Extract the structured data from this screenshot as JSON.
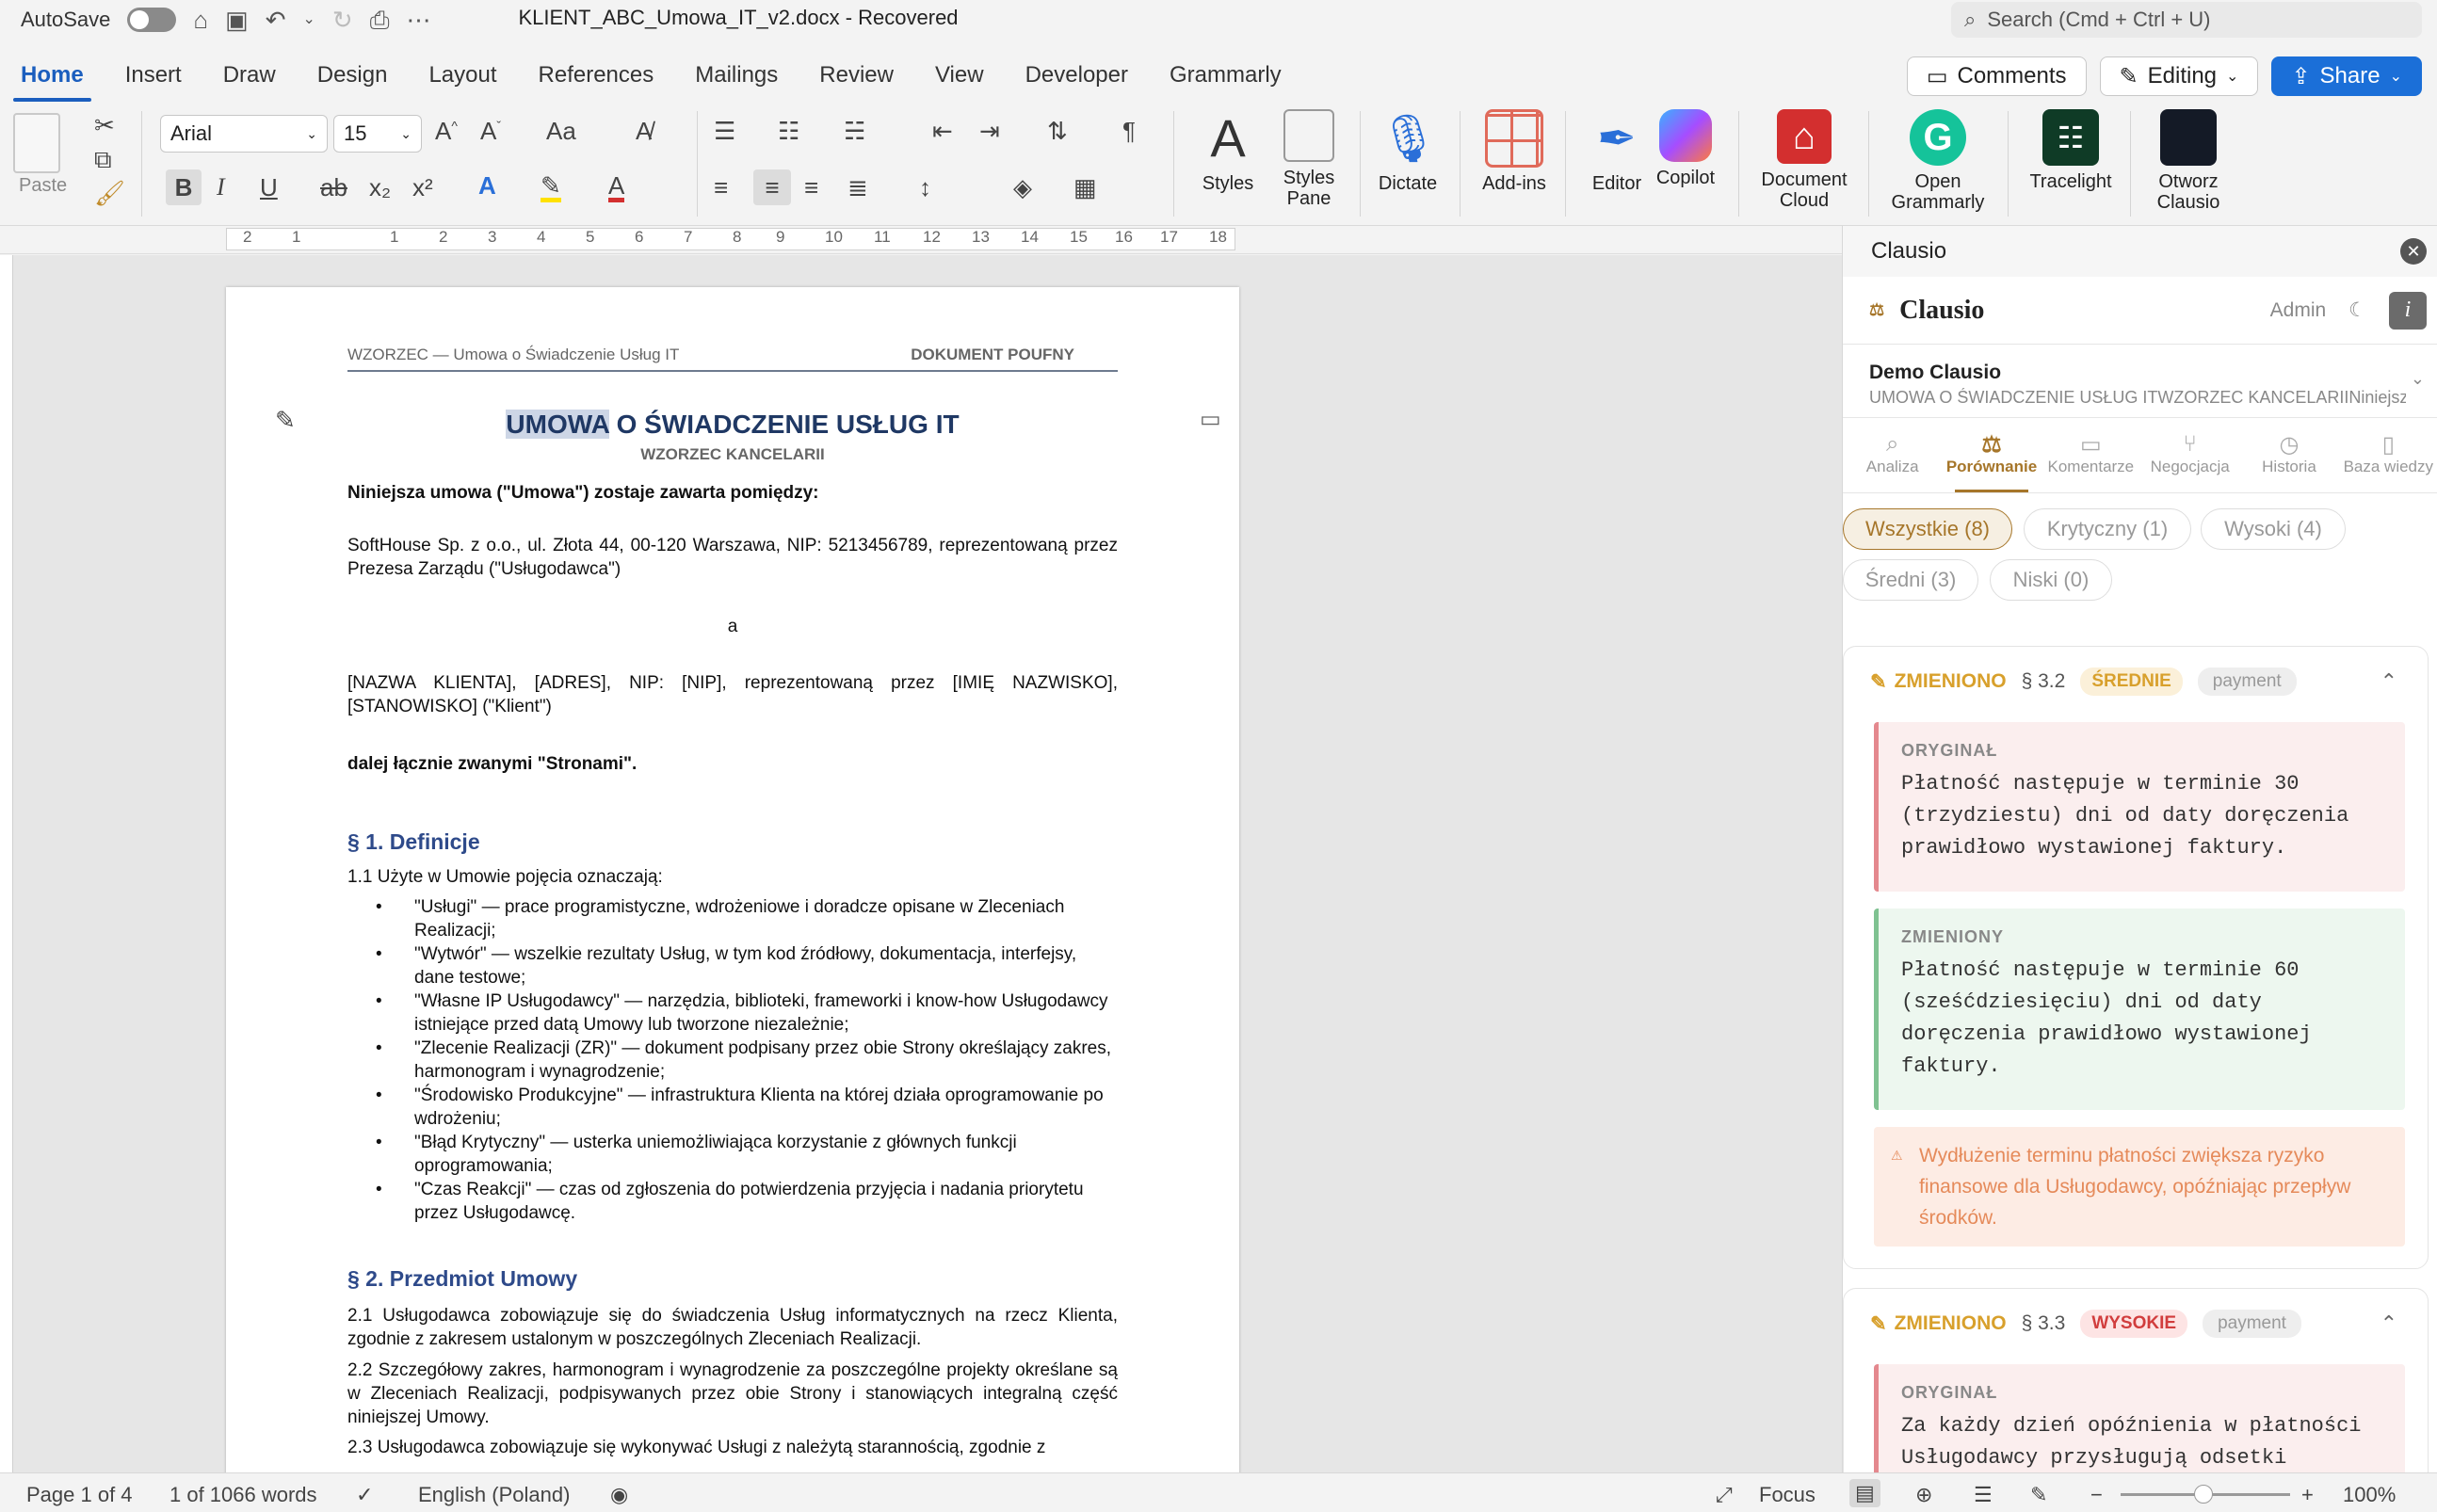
{
  "titlebar": {
    "autosave": "AutoSave",
    "title": "KLIENT_ABC_Umowa_IT_v2.docx  -  Recovered",
    "search_placeholder": "Search (Cmd + Ctrl + U)"
  },
  "tabs": [
    "Home",
    "Insert",
    "Draw",
    "Design",
    "Layout",
    "References",
    "Mailings",
    "Review",
    "View",
    "Developer",
    "Grammarly"
  ],
  "right_buttons": {
    "comments": "Comments",
    "editing": "Editing",
    "share": "Share"
  },
  "ribbon": {
    "paste": "Paste",
    "font": "Arial",
    "size": "15",
    "styles": "Styles",
    "styles_pane_1": "Styles",
    "styles_pane_2": "Pane",
    "dictate": "Dictate",
    "addins": "Add-ins",
    "editor": "Editor",
    "copilot": "Copilot",
    "doccloud_1": "Document",
    "doccloud_2": "Cloud",
    "grammarly_1": "Open",
    "grammarly_2": "Grammarly",
    "tracelight": "Tracelight",
    "clausio_1": "Otworz",
    "clausio_2": "Clausio"
  },
  "ruler": [
    "2",
    "1",
    "1",
    "2",
    "3",
    "4",
    "5",
    "6",
    "7",
    "8",
    "9",
    "10",
    "11",
    "12",
    "13",
    "14",
    "15",
    "16",
    "17",
    "18"
  ],
  "document": {
    "header_left": "WZORZEC — Umowa o Świadczenie Usług IT",
    "header_right": "DOKUMENT POUFNY",
    "title_hl": "UMOWA",
    "title_rest": " O ŚWIADCZENIE USŁUG IT",
    "subtitle": "WZORZEC KANCELARII",
    "intro": "Niniejsza umowa (\"Umowa\") zostaje zawarta pomiędzy:",
    "party1": "SoftHouse Sp. z o.o., ul. Złota 44, 00-120 Warszawa, NIP: 5213456789, reprezentowaną przez Prezesa Zarządu (\"Usługodawca\")",
    "and": "a",
    "party2": "[NAZWA KLIENTA], [ADRES], NIP: [NIP], reprezentowaną przez [IMIĘ NAZWISKO], [STANOWISKO] (\"Klient\")",
    "parties": "dalej łącznie zwanymi \"Stronami\".",
    "h1": "§ 1. Definicje",
    "p11": "1.1 Użyte w Umowie pojęcia oznaczają:",
    "defs": [
      "\"Usługi\" — prace programistyczne, wdrożeniowe i doradcze opisane w Zleceniach Realizacji;",
      "\"Wytwór\" — wszelkie rezultaty Usług, w tym kod źródłowy, dokumentacja, interfejsy, dane testowe;",
      "\"Własne IP Usługodawcy\" — narzędzia, biblioteki, frameworki i know-how Usługodawcy istniejące przed datą Umowy lub tworzone niezależnie;",
      "\"Zlecenie Realizacji (ZR)\" — dokument podpisany przez obie Strony określający zakres, harmonogram i wynagrodzenie;",
      "\"Środowisko Produkcyjne\" — infrastruktura Klienta na której działa oprogramowanie po wdrożeniu;",
      "\"Błąd Krytyczny\" — usterka uniemożliwiająca korzystanie z głównych funkcji oprogramowania;",
      "\"Czas Reakcji\" — czas od zgłoszenia do potwierdzenia przyjęcia i nadania priorytetu przez Usługodawcę."
    ],
    "h2": "§ 2. Przedmiot Umowy",
    "p21": "2.1 Usługodawca zobowiązuje się do świadczenia Usług informatycznych na rzecz Klienta, zgodnie z zakresem ustalonym w poszczególnych Zleceniach Realizacji.",
    "p22": "2.2 Szczegółowy zakres, harmonogram i wynagrodzenie za poszczególne projekty określane są w Zleceniach Realizacji, podpisywanych przez obie Strony i stanowiących integralną część niniejszej Umowy.",
    "p23": "2.3 Usługodawca zobowiązuje się wykonywać Usługi z należytą starannością, zgodnie z"
  },
  "statusbar": {
    "page": "Page 1 of 4",
    "words": "1 of 1066 words",
    "lang": "English (Poland)",
    "focus": "Focus",
    "zoom": "100%"
  },
  "panel": {
    "title": "Clausio",
    "brand": "Clausio",
    "admin": "Admin",
    "project_name": "Demo Clausio",
    "project_desc": "UMOWA O ŚWIADCZENIE USŁUG ITWZORZEC KANCELARIINiniejsza u",
    "tabs": [
      "Analiza",
      "Porównanie",
      "Komentarze",
      "Negocjacja",
      "Historia",
      "Baza wiedzy"
    ],
    "chips": [
      "Wszystkie (8)",
      "Krytyczny (1)",
      "Wysoki (4)",
      "Średni (3)",
      "Niski (0)"
    ],
    "cards": [
      {
        "status": "ZMIENIONO",
        "section": "§ 3.2",
        "severity": "ŚREDNIE",
        "tag": "payment",
        "orig_label": "ORYGINAŁ",
        "orig": "Płatność następuje w terminie 30 (trzydziestu) dni od daty doręczenia prawidłowo wystawionej faktury.",
        "chg_label": "ZMIENIONY",
        "chg": "Płatność następuje w terminie 60 (sześćdziesięciu) dni od daty doręczenia prawidłowo wystawionej faktury.",
        "warning": "Wydłużenie terminu płatności zwiększa ryzyko finansowe dla Usługodawcy, opóźniając przepływ środków."
      },
      {
        "status": "ZMIENIONO",
        "section": "§ 3.3",
        "severity": "WYSOKIE",
        "tag": "payment",
        "orig_label": "ORYGINAŁ",
        "orig": "Za każdy dzień opóźnienia w płatności Usługodawcy przysługują odsetki"
      }
    ]
  }
}
